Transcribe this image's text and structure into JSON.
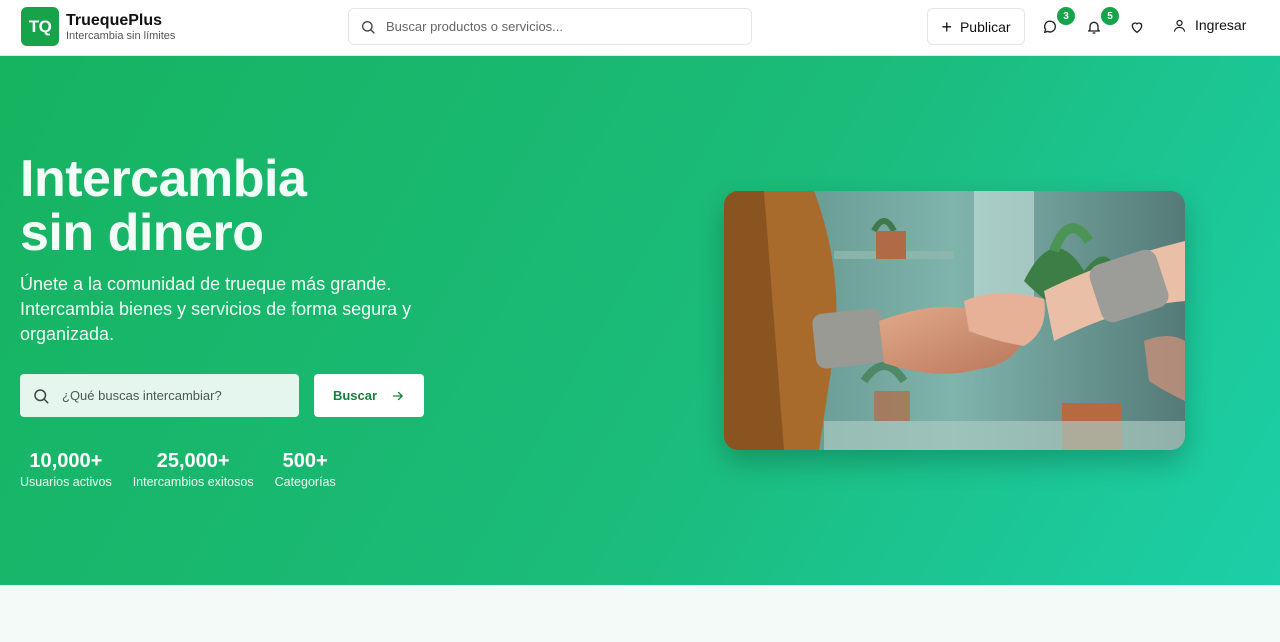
{
  "header": {
    "logo_text": "TQ",
    "brand_name": "TruequePlus",
    "tagline": "Intercambia sin límites",
    "search_placeholder": "Buscar productos o servicios...",
    "publish_label": "Publicar",
    "messages_count": "3",
    "notifications_count": "5",
    "login_label": "Ingresar"
  },
  "hero": {
    "title_line1": "Intercambia",
    "title_line2": "sin dinero",
    "subtitle": "Únete a la comunidad de trueque más grande. Intercambia bienes y servicios de forma segura y organizada.",
    "search_placeholder": "¿Qué buscas intercambiar?",
    "search_button": "Buscar",
    "stats": [
      {
        "value": "10,000+",
        "label": "Usuarios activos"
      },
      {
        "value": "25,000+",
        "label": "Intercambios exitosos"
      },
      {
        "value": "500+",
        "label": "Categorías"
      }
    ]
  },
  "colors": {
    "brand": "#16a34a",
    "hero_start": "#16b360",
    "hero_end": "#1ccfa8"
  },
  "icons": [
    "search-icon",
    "plus-icon",
    "chat-icon",
    "bell-icon",
    "heart-icon",
    "user-icon",
    "arrow-right-icon"
  ]
}
